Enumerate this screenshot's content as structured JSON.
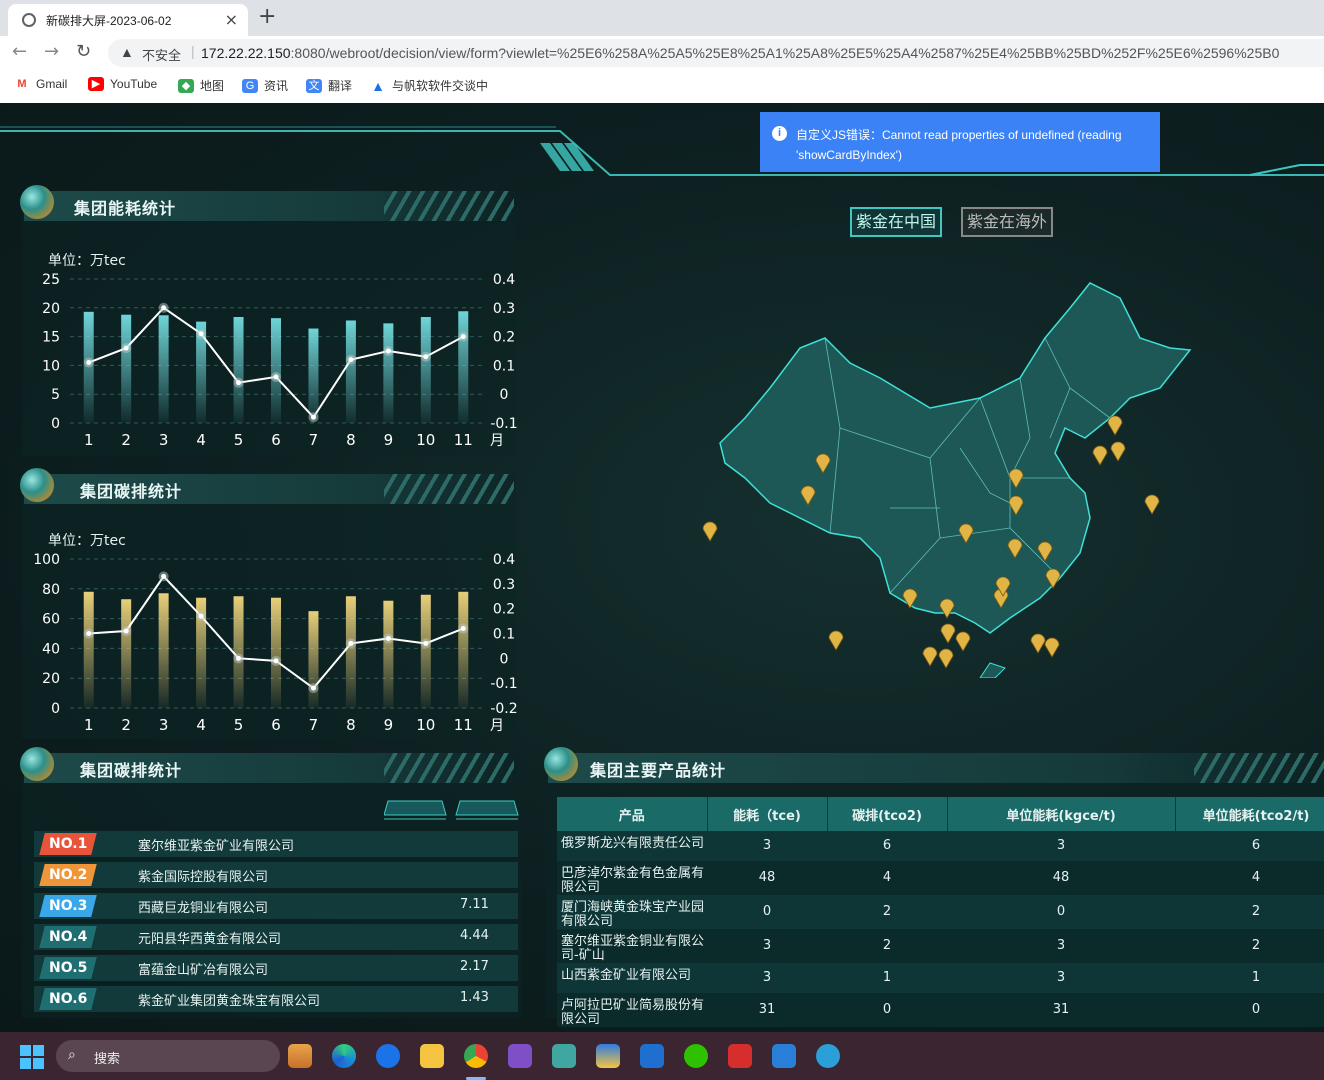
{
  "browser": {
    "tab_title": "新碳排大屏-2023-06-02",
    "insecure_label": "不安全",
    "url_host": "172.22.22.150",
    "url_rest": ":8080/webroot/decision/view/form?viewlet=%25E6%258A%25A5%25E8%25A1%25A8%25E5%25A4%2587%25E4%25BB%25BD%252F%25E6%2596%25B0",
    "bookmarks": [
      "Gmail",
      "YouTube",
      "地图",
      "资讯",
      "翻译",
      "与帆软软件交谈中"
    ]
  },
  "toast": {
    "text": "自定义JS错误：Cannot read properties of undefined (reading 'showCardByIndex')"
  },
  "map_tabs": {
    "china": "紫金在中国",
    "overseas": "紫金在海外"
  },
  "energy_panel": {
    "title": "集团能耗统计",
    "unit": "单位：万tec",
    "x_suffix": "月",
    "bar_color": "#6fd5d8",
    "line_color": "#ffffff"
  },
  "carbon_panel": {
    "title": "集团碳排统计",
    "unit": "单位：万tec",
    "x_suffix": "月",
    "bar_color": "#e8cf7a",
    "line_color": "#ffffff"
  },
  "chart_data": [
    {
      "type": "bar",
      "categories": [
        "1",
        "2",
        "3",
        "4",
        "5",
        "6",
        "7",
        "8",
        "9",
        "10",
        "11"
      ],
      "series": [
        {
          "values": [
            19.3,
            18.8,
            18.7,
            17.6,
            18.4,
            18.2,
            16.4,
            17.8,
            17.3,
            18.4,
            19.4
          ],
          "axis": "left"
        },
        {
          "type": "line",
          "values": [
            0.11,
            0.16,
            0.3,
            0.21,
            0.04,
            0.06,
            -0.08,
            0.12,
            0.15,
            0.13,
            0.2
          ],
          "axis": "right"
        }
      ],
      "xlabel": "月",
      "ylabel": "单位：万tec",
      "ylim": [
        0,
        25
      ],
      "ylim_right": [
        -0.1,
        0.4
      ],
      "yticks": [
        0,
        5,
        10,
        15,
        20,
        25
      ],
      "yticks_right": [
        -0.1,
        0,
        0.1,
        0.2,
        0.3,
        0.4
      ]
    },
    {
      "type": "bar",
      "categories": [
        "1",
        "2",
        "3",
        "4",
        "5",
        "6",
        "7",
        "8",
        "9",
        "10",
        "11"
      ],
      "series": [
        {
          "values": [
            78,
            73,
            77,
            74,
            75,
            74,
            65,
            75,
            72,
            76,
            78
          ],
          "axis": "left"
        },
        {
          "type": "line",
          "values": [
            0.1,
            0.11,
            0.33,
            0.17,
            0,
            -0.01,
            -0.12,
            0.06,
            0.08,
            0.06,
            0.12
          ],
          "axis": "right"
        }
      ],
      "xlabel": "月",
      "ylabel": "单位：万tec",
      "ylim": [
        0,
        100
      ],
      "ylim_right": [
        -0.2,
        0.4
      ],
      "yticks": [
        0,
        20,
        40,
        60,
        80,
        100
      ],
      "yticks_right": [
        -0.2,
        -0.1,
        0,
        0.1,
        0.2,
        0.3,
        0.4
      ]
    },
    {
      "type": "table",
      "columns": [
        "产品",
        "能耗（tce)",
        "碳排(tco2)",
        "单位能耗(kgce/t)",
        "单位能耗(tco2/t)"
      ],
      "rows": [
        [
          "俄罗斯龙兴有限责任公司",
          "3",
          "6",
          "3",
          "6"
        ],
        [
          "巴彦淖尔紫金有色金属有限公司",
          "48",
          "4",
          "48",
          "4"
        ],
        [
          "厦门海峡黄金珠宝产业园有限公司",
          "0",
          "2",
          "0",
          "2"
        ],
        [
          "塞尔维亚紫金铜业有限公司-矿山",
          "3",
          "2",
          "3",
          "2"
        ],
        [
          "山西紫金矿业有限公司",
          "3",
          "1",
          "3",
          "1"
        ],
        [
          "卢阿拉巴矿业简易股份有限公司",
          "31",
          "0",
          "31",
          "0"
        ]
      ]
    }
  ],
  "ranking_panel": {
    "title": "集团碳排统计",
    "rows": [
      {
        "rank": "NO.1",
        "name": "塞尔维亚紫金矿业有限公司",
        "value": "",
        "color": "#e8543a"
      },
      {
        "rank": "NO.2",
        "name": "紫金国际控股有限公司",
        "value": "",
        "color": "#f0963a"
      },
      {
        "rank": "NO.3",
        "name": "西藏巨龙铜业有限公司",
        "value": "7.11",
        "color": "#3aa7e8"
      },
      {
        "rank": "NO.4",
        "name": "元阳县华西黄金有限公司",
        "value": "4.44",
        "color": "#1f6f72"
      },
      {
        "rank": "NO.5",
        "name": "富蕴金山矿冶有限公司",
        "value": "2.17",
        "color": "#1f6f72"
      },
      {
        "rank": "NO.6",
        "name": "紫金矿业集团黄金珠宝有限公司",
        "value": "1.43",
        "color": "#1f6f72"
      }
    ]
  },
  "product_panel": {
    "title": "集团主要产品统计"
  },
  "taskbar": {
    "search_placeholder": "搜索"
  }
}
